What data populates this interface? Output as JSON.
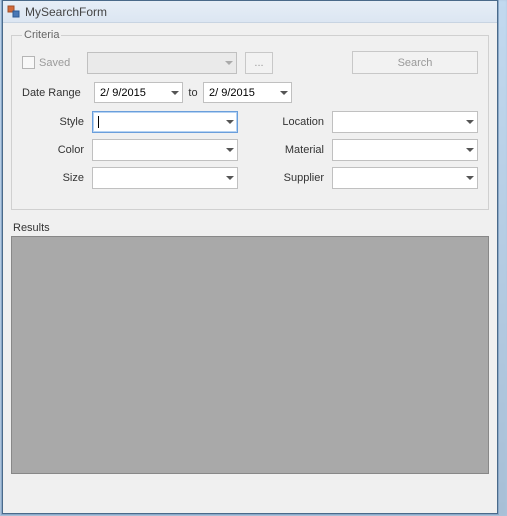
{
  "window": {
    "title": "MySearchForm"
  },
  "criteria": {
    "legend": "Criteria",
    "saved_label": "Saved",
    "saved_checked": false,
    "saved_combo_value": "",
    "ellipsis_label": "...",
    "search_button_label": "Search",
    "date_range_label": "Date Range",
    "date_from": "2/ 9/2015",
    "to_label": "to",
    "date_to": "2/ 9/2015",
    "left_fields": [
      {
        "label": "Style",
        "value": "",
        "focused": true
      },
      {
        "label": "Color",
        "value": ""
      },
      {
        "label": "Size",
        "value": ""
      }
    ],
    "right_fields": [
      {
        "label": "Location",
        "value": ""
      },
      {
        "label": "Material",
        "value": ""
      },
      {
        "label": "Supplier",
        "value": ""
      }
    ]
  },
  "results": {
    "label": "Results"
  }
}
